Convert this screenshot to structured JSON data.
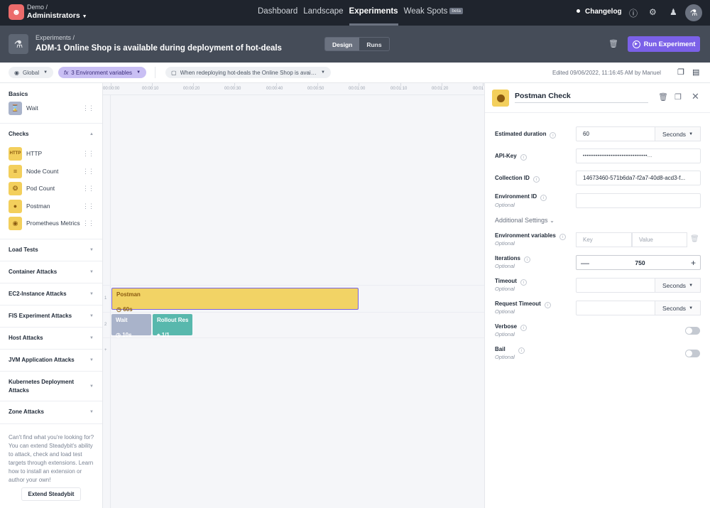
{
  "topbar": {
    "org_sub": "Demo /",
    "org_name": "Administrators",
    "nav": [
      {
        "label": "Dashboard",
        "active": false
      },
      {
        "label": "Landscape",
        "active": false
      },
      {
        "label": "Experiments",
        "active": true
      },
      {
        "label": "Weak Spots",
        "active": false,
        "badge": "beta"
      }
    ],
    "changelog": "Changelog"
  },
  "experiment": {
    "breadcrumb": "Experiments /",
    "title": "ADM-1  Online Shop is available during deployment of hot-deals",
    "tabs": [
      "Design",
      "Runs"
    ],
    "active_tab": "Design",
    "run_button": "Run Experiment",
    "accent_color": "#7b61e8"
  },
  "toolbar": {
    "environment": "Global",
    "env_vars": "3 Environment variables",
    "env_vars_prefix": "fx",
    "hypothesis": "When redeploying hot-deals the Online Shop is avail...",
    "edited": "Edited 09/06/2022, 11:16:45 AM by Manuel"
  },
  "sidebar": {
    "basics": {
      "title": "Basics",
      "items": [
        {
          "label": "Wait",
          "icon": "hourglass-icon"
        }
      ]
    },
    "checks": {
      "title": "Checks",
      "items": [
        {
          "label": "HTTP",
          "icon": "http-icon"
        },
        {
          "label": "Node Count",
          "icon": "layers-icon"
        },
        {
          "label": "Pod Count",
          "icon": "pod-icon"
        },
        {
          "label": "Postman",
          "icon": "postman-icon"
        },
        {
          "label": "Prometheus Metrics",
          "icon": "prometheus-icon"
        }
      ]
    },
    "categories": [
      "Load Tests",
      "Container Attacks",
      "EC2-Instance Attacks",
      "FIS Experiment Attacks",
      "Host Attacks",
      "JVM Application Attacks",
      "Kubernetes Deployment Attacks",
      "Zone Attacks"
    ],
    "help_text": "Can't find what you're looking for? You can extend Steadybit's ability to attack, check and load test targets through extensions. Learn how to install an extension or author your own!",
    "extend_button": "Extend Steadybit"
  },
  "timeline": {
    "ticks": [
      "00:00:00",
      "00:00:10",
      "00:00:20",
      "00:00:30",
      "00:00:40",
      "00:00:50",
      "00:01:00",
      "00:01:10",
      "00:01:20",
      "00:01"
    ],
    "lanes": [
      "1",
      "2",
      "+"
    ],
    "steps": [
      {
        "lane": 1,
        "name": "Postman",
        "meta": "60s",
        "meta_icon": "clock-icon"
      },
      {
        "lane": 2,
        "name": "Wait",
        "meta": "10s",
        "meta_icon": "clock-icon"
      },
      {
        "lane": 2,
        "name": "Rollout Resta",
        "meta": "1/1",
        "meta_icon": "target-icon"
      }
    ]
  },
  "panel": {
    "title": "Postman Check",
    "fields": {
      "estimated_duration": {
        "label": "Estimated duration",
        "value": "60",
        "unit": "Seconds"
      },
      "api_key": {
        "label": "API-Key",
        "value": "•••••••••••••••••••••••••••••••••••..."
      },
      "collection_id": {
        "label": "Collection ID",
        "value": "14673460-571b6da7-f2a7-40d8-acd3-f..."
      },
      "environment_id": {
        "label": "Environment ID",
        "optional": "Optional",
        "value": ""
      },
      "additional_settings": "Additional Settings",
      "env_variables": {
        "label": "Environment variables",
        "optional": "Optional",
        "key_placeholder": "Key",
        "value_placeholder": "Value"
      },
      "iterations": {
        "label": "Iterations",
        "optional": "Optional",
        "value": "750"
      },
      "timeout": {
        "label": "Timeout",
        "optional": "Optional",
        "unit": "Seconds"
      },
      "request_timeout": {
        "label": "Request Timeout",
        "optional": "Optional",
        "unit": "Seconds"
      },
      "verbose": {
        "label": "Verbose",
        "optional": "Optional",
        "enabled": false
      },
      "bail": {
        "label": "Bail",
        "optional": "Optional",
        "enabled": false
      }
    }
  }
}
